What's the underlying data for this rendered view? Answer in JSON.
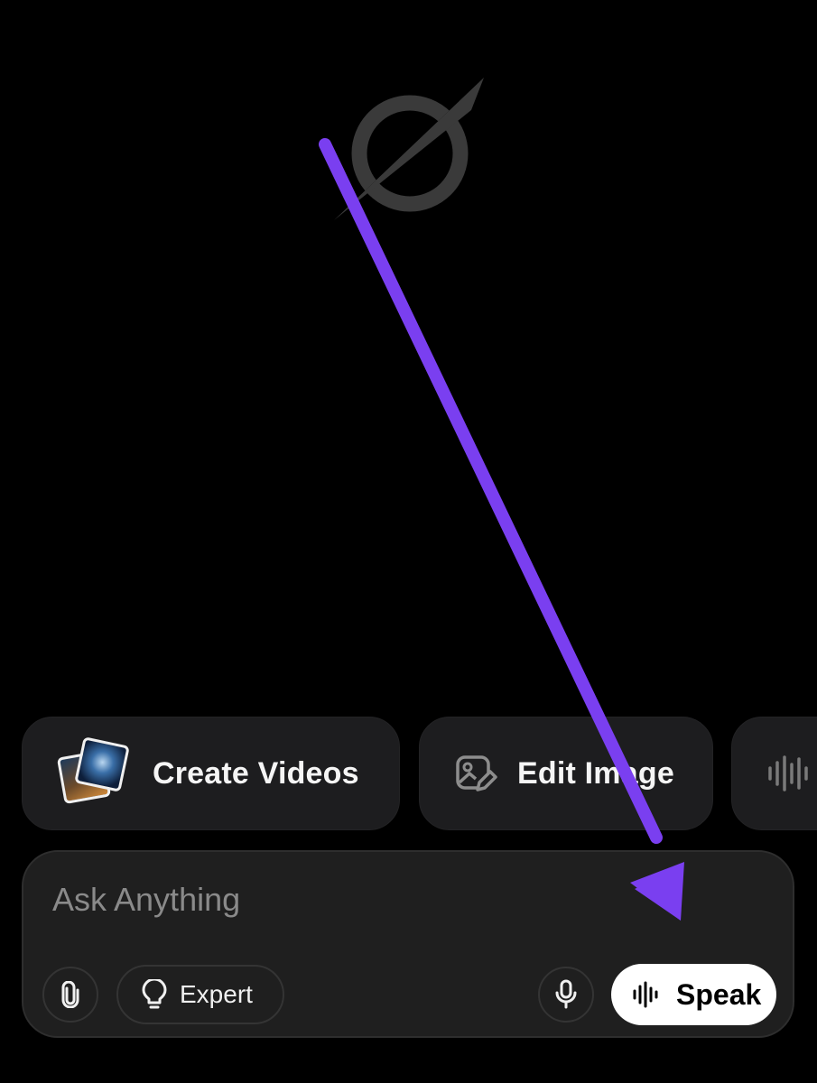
{
  "chips": [
    {
      "label": "Create Videos",
      "icon": "video-thumbnails-icon"
    },
    {
      "label": "Edit Image",
      "icon": "edit-image-icon"
    },
    {
      "label": "",
      "icon": "waveform-icon"
    }
  ],
  "composer": {
    "placeholder": "Ask Anything",
    "attach_icon": "paperclip-icon",
    "mode_label": "Expert",
    "mode_icon": "lightbulb-icon",
    "mic_icon": "microphone-icon",
    "speak_label": "Speak",
    "speak_icon": "waveform-icon"
  },
  "colors": {
    "background": "#000000",
    "chip": "#1d1d1f",
    "annotation_arrow": "#7a3ff0",
    "speak_button": "#ffffff"
  }
}
